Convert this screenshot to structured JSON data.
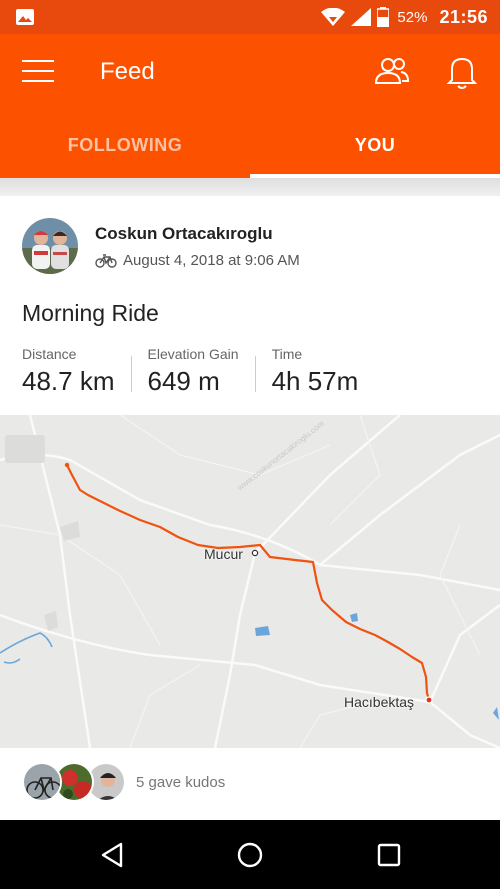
{
  "status_bar": {
    "battery": "52%",
    "time": "21:56"
  },
  "app_bar": {
    "title": "Feed"
  },
  "tabs": [
    {
      "label": "FOLLOWING"
    },
    {
      "label": "YOU"
    }
  ],
  "activity": {
    "athlete": "Coskun Ortacakıroglu",
    "date": "August 4, 2018 at 9:06 AM",
    "title": "Morning Ride",
    "stats": [
      {
        "label": "Distance",
        "value": "48.7 km"
      },
      {
        "label": "Elevation Gain",
        "value": "649 m"
      },
      {
        "label": "Time",
        "value": "4h 57m"
      }
    ],
    "map": {
      "places": [
        "Mucur",
        "Hacıbektaş"
      ]
    },
    "kudos": "5 gave kudos"
  },
  "colors": {
    "brand": "#fc5200",
    "status_bar": "#e8490d",
    "route": "#f0520f"
  }
}
